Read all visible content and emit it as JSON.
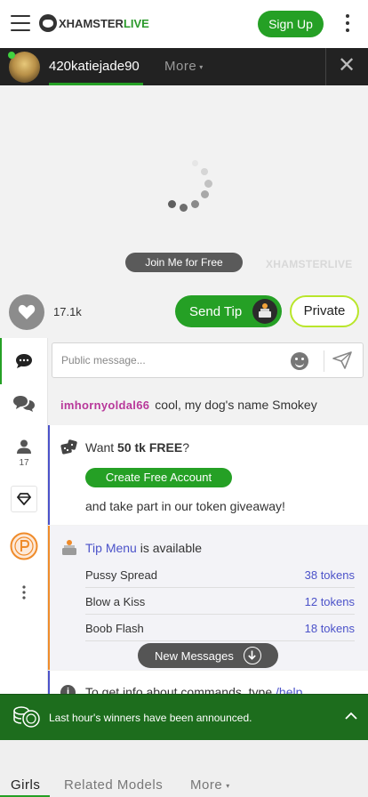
{
  "header": {
    "logo_text": "XHAMSTER",
    "logo_live": "LIVE",
    "signup_label": "Sign Up"
  },
  "model_bar": {
    "username": "420katiejade90",
    "more_label": "More"
  },
  "video": {
    "join_label": "Join Me for Free",
    "watermark": "XHAMSTERLIVE"
  },
  "actions": {
    "likes": "17.1k",
    "send_tip_label": "Send Tip",
    "private_label": "Private"
  },
  "sidebar": {
    "users_count": "17"
  },
  "chat": {
    "input_placeholder": "Public message...",
    "messages": [
      {
        "user": "imhornyoldal66",
        "text": "cool, my dog's name Smokey"
      }
    ],
    "promo": {
      "title_prefix": "Want",
      "title_bold": "50 tk FREE",
      "title_suffix": "?",
      "button_label": "Create Free Account",
      "subtitle": "and take part in our token giveaway!"
    },
    "tip_menu": {
      "link_label": "Tip Menu",
      "suffix": "is available",
      "items": [
        {
          "name": "Pussy Spread",
          "price": "38 tokens"
        },
        {
          "name": "Blow a Kiss",
          "price": "12 tokens"
        },
        {
          "name": "Boob Flash",
          "price": "18 tokens"
        }
      ]
    },
    "new_messages_label": "New Messages",
    "info": {
      "text": "To get info about commands, type",
      "command": "/help"
    }
  },
  "winners": {
    "text": "Last hour's winners have been announced."
  },
  "bottom_tabs": [
    {
      "label": "Girls"
    },
    {
      "label": "Related Models"
    },
    {
      "label": "More"
    }
  ],
  "colors": {
    "brand_green": "#25a025",
    "accent_blue": "#4b52c9",
    "tip_orange": "#ef8b2a",
    "private_border": "#b9e62b",
    "username_pink": "#b8389a"
  }
}
